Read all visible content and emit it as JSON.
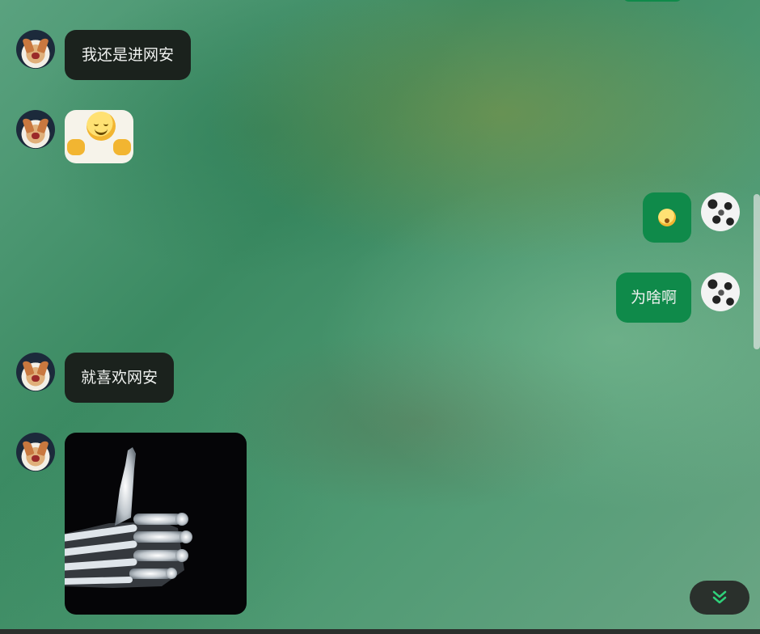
{
  "chat": {
    "messages": [
      {
        "side": "left",
        "type": "text",
        "text": "我还是进网安"
      },
      {
        "side": "left",
        "type": "emoji"
      },
      {
        "side": "right",
        "type": "emoji"
      },
      {
        "side": "right",
        "type": "text",
        "text": "为啥啊"
      },
      {
        "side": "left",
        "type": "text",
        "text": "就喜欢网安"
      },
      {
        "side": "left",
        "type": "image"
      }
    ]
  },
  "colors": {
    "left_bubble": "#1b221d",
    "right_bubble": "#0f8a4a",
    "bubble_text": "#f0f2f0",
    "scroll_button_bg": "#2a302c",
    "scroll_button_icon": "#2fd07a"
  },
  "icons": {
    "scroll_down": "double-chevron-down-icon"
  }
}
